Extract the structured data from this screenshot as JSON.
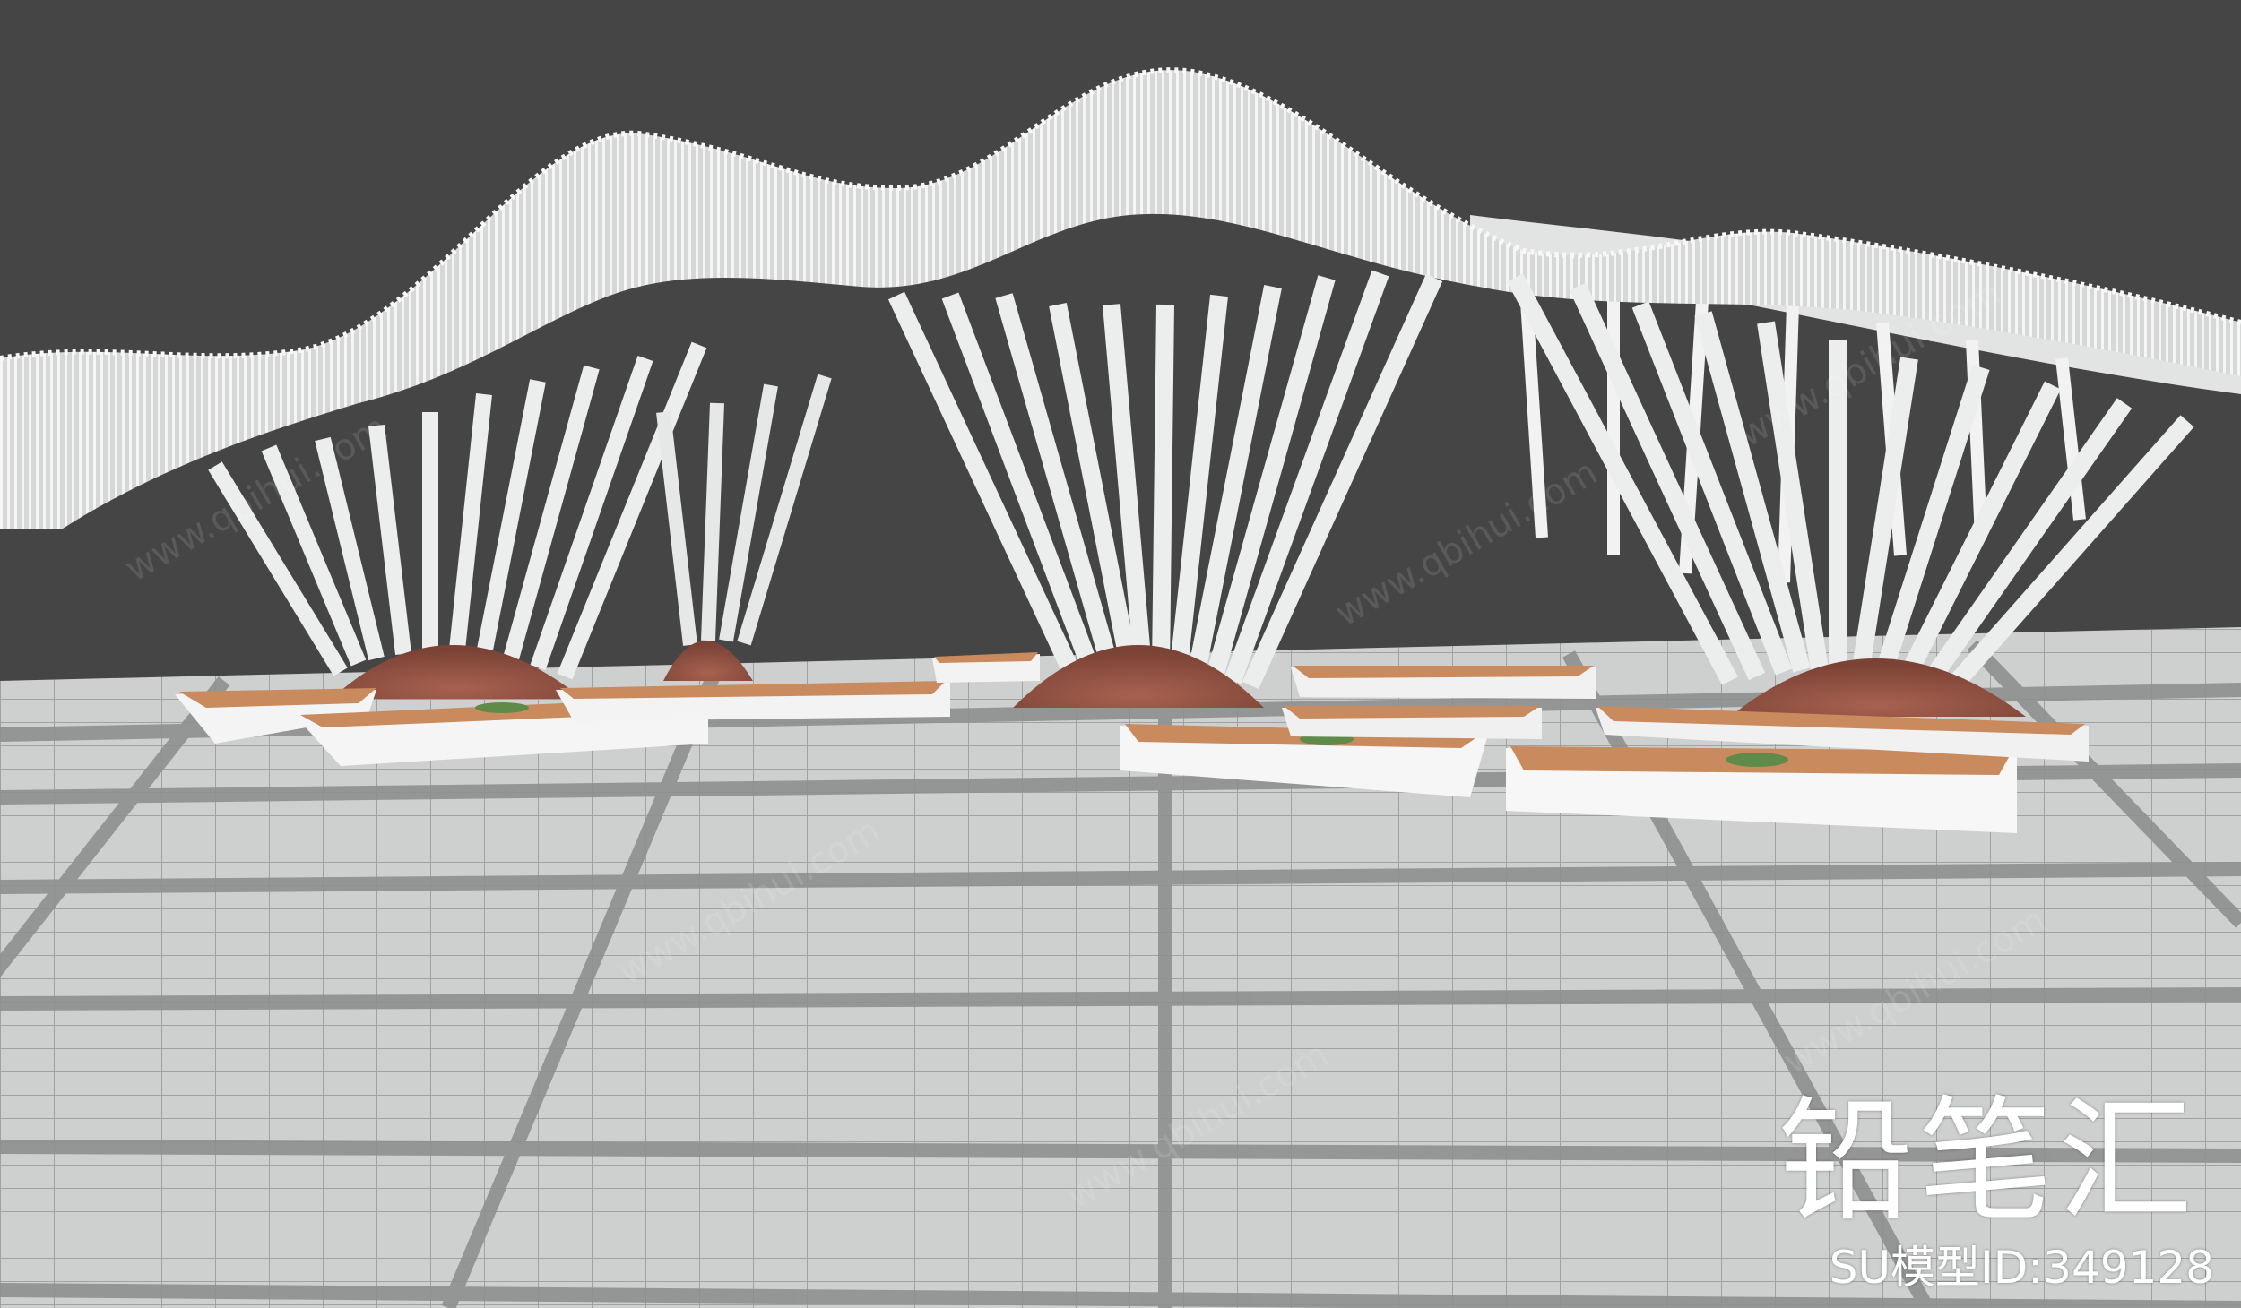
{
  "watermark": {
    "brand": "铅笔汇",
    "model_id": "SU模型ID:349128",
    "url": "www.qbihui.com"
  },
  "colors": {
    "sky": "#454545",
    "floor_tile": "#cfd2d0",
    "floor_band": "#8f9190",
    "structure": "#e8eae9",
    "planter_soil": "#c98a5e",
    "brick_mound": "#9b5a49",
    "grass": "#5f8a4a"
  }
}
